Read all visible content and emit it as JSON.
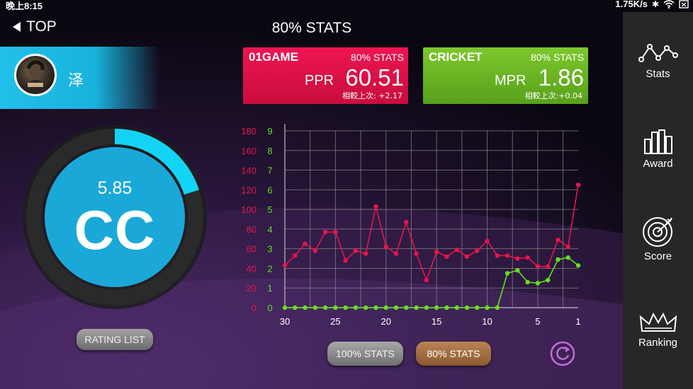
{
  "status_bar": {
    "time": "晚上8:15",
    "network_speed": "1.75K/s"
  },
  "nav": {
    "back_label": "TOP",
    "title": "80% STATS"
  },
  "user": {
    "name": "泽"
  },
  "rating": {
    "value": "5.85",
    "grade": "CC",
    "progress": 0.2
  },
  "cards": {
    "game01": {
      "title": "01GAME",
      "stats": "80% STATS",
      "label": "PPR",
      "value": "60.51",
      "compare": "相較上次: +2.17",
      "color": "#e0124a"
    },
    "cricket": {
      "title": "CRICKET",
      "stats": "80% STATS",
      "label": "MPR",
      "value": "1.86",
      "compare": "相較上次:+0.04",
      "color": "#6ab524"
    }
  },
  "buttons": {
    "rating_list": "RATING LIST",
    "stats100": "100% STATS",
    "stats80": "80% STATS"
  },
  "sidebar": {
    "items": [
      {
        "label": "Stats",
        "icon": "stats-icon"
      },
      {
        "label": "Award",
        "icon": "award-icon"
      },
      {
        "label": "Score",
        "icon": "score-icon"
      },
      {
        "label": "Ranking",
        "icon": "ranking-icon"
      }
    ]
  },
  "chart_data": {
    "type": "line",
    "x": [
      30,
      29,
      28,
      27,
      26,
      25,
      24,
      23,
      22,
      21,
      20,
      19,
      18,
      17,
      16,
      15,
      14,
      13,
      12,
      11,
      10,
      9,
      8,
      7,
      6,
      5,
      4,
      3,
      2,
      1
    ],
    "x_ticks": [
      30,
      25,
      20,
      15,
      10,
      5,
      1
    ],
    "ylim_left": [
      0,
      180
    ],
    "ylim_right": [
      0,
      9
    ],
    "y_ticks_left": [
      0,
      20,
      40,
      60,
      80,
      100,
      120,
      140,
      160,
      180
    ],
    "y_ticks_right": [
      0,
      1,
      2,
      3,
      4,
      5,
      6,
      7,
      8,
      9
    ],
    "grid": true,
    "series": [
      {
        "axis": "left",
        "color": "#e8144c",
        "values": [
          43,
          53,
          65,
          58,
          77,
          77,
          48,
          58,
          55,
          103,
          62,
          55,
          87,
          55,
          28,
          57,
          52,
          59,
          52,
          58,
          68,
          53,
          53,
          50,
          51,
          42,
          42,
          69,
          62,
          125
        ]
      },
      {
        "axis": "right",
        "color": "#66dd22",
        "values": [
          0,
          0,
          0,
          0,
          0,
          0,
          0,
          0,
          0,
          0,
          0,
          0,
          0,
          0,
          0,
          0,
          0,
          0,
          0,
          0,
          0,
          0,
          1.75,
          1.9,
          1.3,
          1.25,
          1.4,
          2.45,
          2.55,
          2.15
        ]
      }
    ]
  }
}
